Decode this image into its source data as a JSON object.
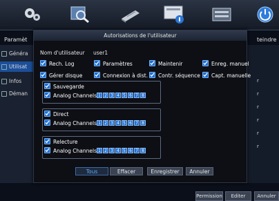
{
  "top_bar": {
    "icons": [
      "gear-icon",
      "search-icon",
      "disk-icon",
      "monitor-user-icon",
      "network-icon",
      "power-icon"
    ]
  },
  "background": {
    "left_title": "Paramèt",
    "right_title": "teindre",
    "sidebar": [
      {
        "label": "Généra",
        "icon": "gear-icon"
      },
      {
        "label": "Utilisat",
        "icon": "user-icon"
      },
      {
        "label": "Infos",
        "icon": "info-icon"
      },
      {
        "label": "Déman",
        "icon": "start-icon"
      }
    ],
    "right_items": [
      "r",
      "r",
      "r",
      "r",
      "r",
      "r"
    ],
    "bottom_buttons": [
      "Permission",
      "Editer",
      "Annuler"
    ]
  },
  "dialog": {
    "title": "Autorisations de l'utilisateur",
    "username_label": "Nom d'utilisateur",
    "username_value": "user1",
    "permissions": [
      {
        "label": "Rech. Log",
        "checked": true
      },
      {
        "label": "Paramètres",
        "checked": true
      },
      {
        "label": "Maintenir",
        "checked": true
      },
      {
        "label": "Enreg. manuel",
        "checked": true
      },
      {
        "label": "Gérer disque",
        "checked": true
      },
      {
        "label": "Connexion à dist.",
        "checked": true
      },
      {
        "label": "Contr. séquence",
        "checked": true
      },
      {
        "label": "Capt. manuelle",
        "checked": true
      }
    ],
    "groups": [
      {
        "title": "Sauvegarde",
        "channels_label": "Analog Channels",
        "channels": [
          "1",
          "2",
          "3",
          "4",
          "5",
          "6",
          "7",
          "8"
        ]
      },
      {
        "title": "Direct",
        "channels_label": "Analog Channels",
        "channels": [
          "1",
          "2",
          "3",
          "4",
          "5",
          "6",
          "7",
          "8"
        ]
      },
      {
        "title": "Relecture",
        "channels_label": "Analog Channels",
        "channels": [
          "1",
          "2",
          "3",
          "4",
          "5",
          "6",
          "7",
          "8"
        ]
      }
    ],
    "buttons": {
      "all": "Tous",
      "clear": "Effacer",
      "save": "Enregistrer",
      "cancel": "Annuler"
    }
  },
  "colors": {
    "accent": "#1d6fd6",
    "active_nav": "#1c4f9a",
    "primary_button_text": "#5fb0ff"
  }
}
